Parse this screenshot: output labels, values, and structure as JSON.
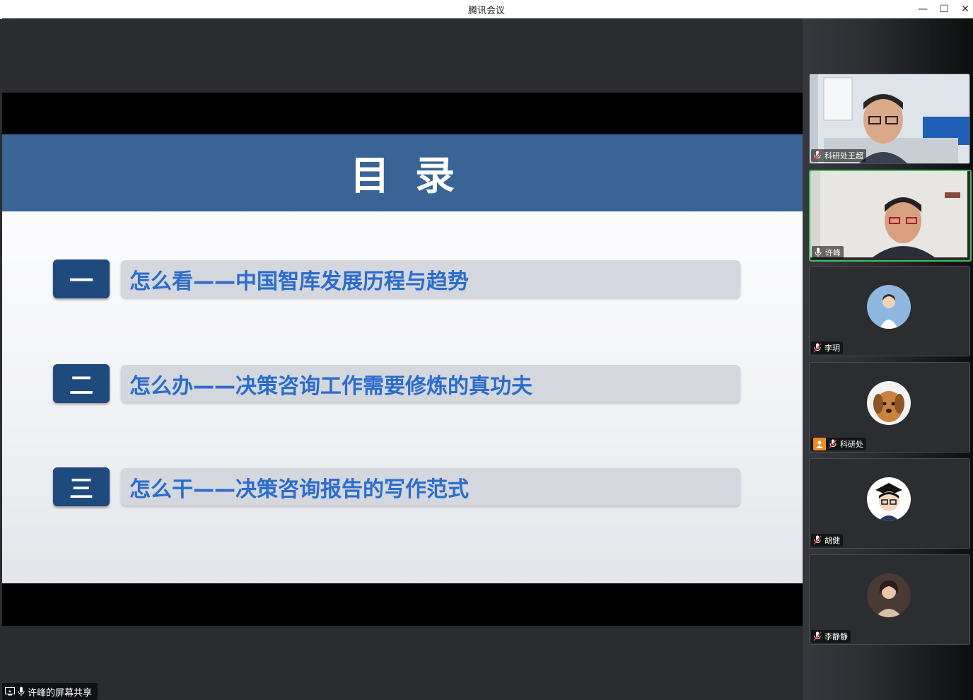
{
  "window": {
    "title": "腾讯会议",
    "minimize": "—",
    "maximize": "☐",
    "close": "✕"
  },
  "slide": {
    "title": "目录",
    "items": [
      {
        "num": "一",
        "text": "怎么看——中国智库发展历程与趋势"
      },
      {
        "num": "二",
        "text": "怎么办——决策咨询工作需要修炼的真功夫"
      },
      {
        "num": "三",
        "text": "怎么干——决策咨询报告的写作范式"
      }
    ]
  },
  "share_label": "许峰的屏幕共享",
  "participants": [
    {
      "name": "科研处王超",
      "muted": true,
      "video": true
    },
    {
      "name": "许峰",
      "muted": false,
      "video": true,
      "speaking": true
    },
    {
      "name": "李玥",
      "muted": true,
      "video": false
    },
    {
      "name": "科研处",
      "muted": true,
      "video": false,
      "host": true
    },
    {
      "name": "胡健",
      "muted": true,
      "video": false
    },
    {
      "name": "李静静",
      "muted": true,
      "video": false
    }
  ],
  "colors": {
    "slide_header": "#3a6495",
    "toc_number_bg": "#1f4a7e",
    "toc_text": "#2b6ccc",
    "active_speaker_border": "#3fbf5a",
    "host_badge": "#f08a22"
  }
}
